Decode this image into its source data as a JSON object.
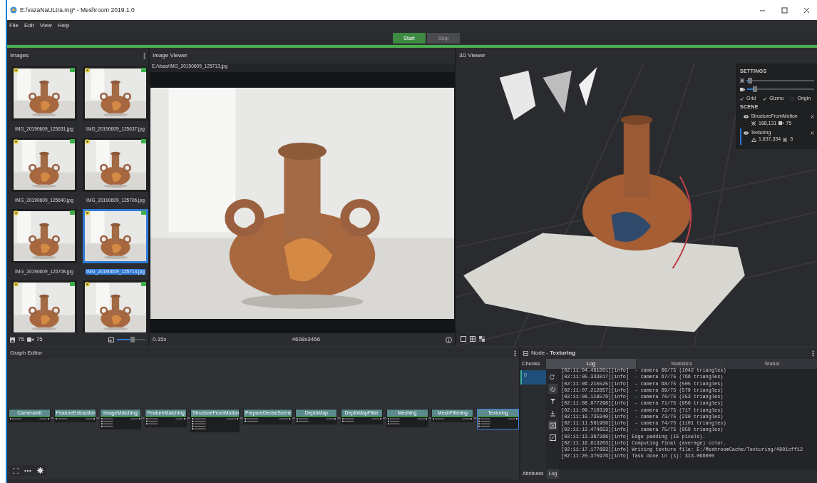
{
  "window": {
    "title": "E:/vazaNaULtra.mg* - Meshroom 2019.1.0"
  },
  "menu": [
    "File",
    "Edit",
    "View",
    "Help"
  ],
  "toolbar": {
    "buttons": [
      {
        "label": "Start",
        "disabled": false
      },
      {
        "label": "Stop",
        "disabled": true
      }
    ],
    "progress": {
      "level": 1
    }
  },
  "images_panel": {
    "title": "Images",
    "thumbnails": [
      {
        "filename": "IMG_20190609_125631.jpg",
        "selected": false
      },
      {
        "filename": "IMG_20190609_125637.jpg",
        "selected": false
      },
      {
        "filename": "IMG_20190609_125640.jpg",
        "selected": false
      },
      {
        "filename": "IMG_20190609_125706.jpg",
        "selected": false
      },
      {
        "filename": "IMG_20190609_125708.jpg",
        "selected": false
      },
      {
        "filename": "IMG_20190609_125713.jpg",
        "selected": true
      },
      {
        "selected": false
      },
      {
        "selected": false
      }
    ],
    "image_count": "75",
    "camera_count": "75",
    "thumbnail_size": {
      "level": 0.55
    }
  },
  "image_viewer": {
    "title": "Image Viewer",
    "path": "E:/Vaza/IMG_20190609_125713.jpg",
    "zoom": "0.15x",
    "resolution": "4608x3456"
  },
  "viewer_3d": {
    "title": "3D Viewer",
    "settings": {
      "title": "SETTINGS",
      "point_size": {
        "level": 0.05
      },
      "camera_scale": {
        "level": 0.12
      },
      "toggles": [
        {
          "label": "Grid",
          "checked": true
        },
        {
          "label": "Gizmo",
          "checked": true
        },
        {
          "label": "Origin",
          "checked": false
        }
      ]
    },
    "scene": {
      "title": "SCENE",
      "items": [
        {
          "name": "StructureFromMotion",
          "selected": false,
          "stats": [
            {
              "kind": "points",
              "value": "168,131"
            },
            {
              "kind": "cameras",
              "value": "75"
            }
          ]
        },
        {
          "name": "Texturing",
          "selected": true,
          "stats": [
            {
              "kind": "triangles",
              "value": "1,637,334"
            },
            {
              "kind": "points",
              "value": "3"
            }
          ]
        }
      ]
    }
  },
  "graph_editor": {
    "title": "Graph Editor",
    "nodes": [
      {
        "name": "CameraInit",
        "selected": false
      },
      {
        "name": "FeatureExtraction",
        "selected": false
      },
      {
        "name": "ImageMatching",
        "selected": false
      },
      {
        "name": "FeatureMatching",
        "selected": false
      },
      {
        "name": "StructureFromMotion",
        "selected": false
      },
      {
        "name": "PrepareDenseScene",
        "selected": false
      },
      {
        "name": "DepthMap",
        "selected": false
      },
      {
        "name": "DepthMapFilter",
        "selected": false
      },
      {
        "name": "Meshing",
        "selected": false
      },
      {
        "name": "MeshFiltering",
        "selected": false
      },
      {
        "name": "Texturing",
        "selected": true
      }
    ]
  },
  "node_panel": {
    "title": "Node - **Texturing**",
    "chunks_label": "Chunks",
    "chunks": [
      {
        "label": "0",
        "selected": true
      }
    ],
    "tabs": [
      {
        "label": "Log",
        "selected": true
      },
      {
        "label": "Statistics",
        "selected": false
      },
      {
        "label": "Status",
        "selected": false
      }
    ],
    "log": [
      "[02:11:04.481001][info]  - camera 66/75 (1042 triangles)",
      "[02:11:05.333017][info]  - camera 67/75 (766 triangles)",
      "[02:11:06.215525][info]  - camera 68/75 (505 triangles)",
      "[02:11:07.212857][info]  - camera 69/75 (579 triangles)",
      "[02:11:08.118579][info]  - camera 70/75 (253 triangles)",
      "[02:11:08.977298][info]  - camera 71/75 (956 triangles)",
      "[02:11:09.710319][info]  - camera 72/75 (717 triangles)",
      "[02:11:10.735940][info]  - camera 73/75 (230 triangles)",
      "[02:11:11.561956][info]  - camera 74/75 (1101 triangles)",
      "[02:11:12.474653][info]  - camera 75/75 (959 triangles)",
      "[02:11:13.367266][info] Edge padding (15 pixels).",
      "[02:11:16.613203][info] Computing final (average) color.",
      "[02:11:17.177693][info] Writing texture file: E:/MeshroomCache/Texturing/4801cff12",
      "[02:11:20.375976][info] Task done in (s): 313.066000"
    ],
    "bottom_tabs": [
      {
        "label": "Attributes",
        "selected": false
      },
      {
        "label": "Log",
        "selected": true
      }
    ]
  }
}
